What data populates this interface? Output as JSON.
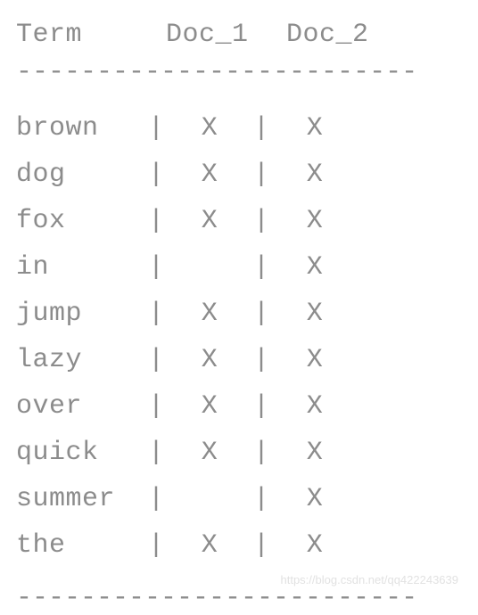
{
  "chart_data": {
    "type": "table",
    "title": "",
    "headers": [
      "Term",
      "Doc_1",
      "Doc_2"
    ],
    "rows": [
      {
        "term": "brown",
        "doc1": "X",
        "doc2": "X"
      },
      {
        "term": "dog",
        "doc1": "X",
        "doc2": "X"
      },
      {
        "term": "fox",
        "doc1": "X",
        "doc2": "X"
      },
      {
        "term": "in",
        "doc1": "",
        "doc2": "X"
      },
      {
        "term": "jump",
        "doc1": "X",
        "doc2": "X"
      },
      {
        "term": "lazy",
        "doc1": "X",
        "doc2": "X"
      },
      {
        "term": "over",
        "doc1": "X",
        "doc2": "X"
      },
      {
        "term": "quick",
        "doc1": "X",
        "doc2": "X"
      },
      {
        "term": "summer",
        "doc1": "",
        "doc2": "X"
      },
      {
        "term": "the",
        "doc1": "X",
        "doc2": "X"
      }
    ]
  },
  "separator": "|",
  "divider": "-------------------------",
  "watermark": "https://blog.csdn.net/qq422243639"
}
